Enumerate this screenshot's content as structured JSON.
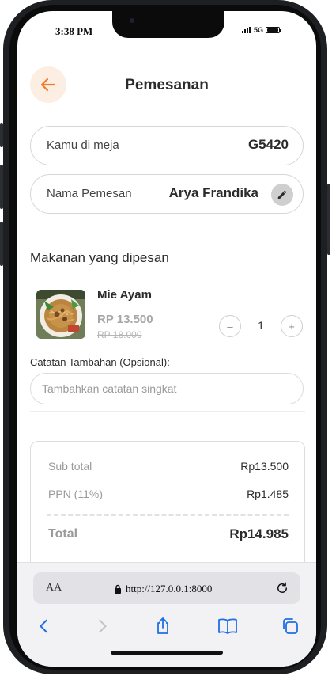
{
  "status_bar": {
    "time": "3:38 PM",
    "network": "5G"
  },
  "header": {
    "title": "Pemesanan",
    "back_icon": "arrow-left-icon"
  },
  "colors": {
    "accent": "#f07c2c",
    "accent_soft": "#fdeee3",
    "browser_blue": "#1f6fe5"
  },
  "table_info": {
    "label": "Kamu di meja",
    "value": "G5420"
  },
  "customer": {
    "label": "Nama Pemesan",
    "value": "Arya Frandika",
    "edit_icon": "pencil-icon"
  },
  "order_section": {
    "title": "Makanan yang dipesan"
  },
  "items": [
    {
      "name": "Mie Ayam",
      "price": "RP 13.500",
      "original_price": "RP 18.000",
      "quantity": "1",
      "image_icon": "noodle-bowl-image"
    }
  ],
  "notes": {
    "label": "Catatan Tambahan (Opsional):",
    "placeholder": "Tambahkan catatan singkat",
    "value": ""
  },
  "summary": {
    "subtotal_label": "Sub total",
    "subtotal_value": "Rp13.500",
    "tax_label": "PPN (11%)",
    "tax_value": "Rp1.485",
    "total_label": "Total",
    "total_value": "Rp14.985"
  },
  "browser": {
    "text_size_label": "AA",
    "url": "http://127.0.0.1:8000",
    "icons": [
      "back-chevron-icon",
      "forward-chevron-icon",
      "share-icon",
      "bookmarks-icon",
      "tabs-icon",
      "reload-icon",
      "lock-icon"
    ]
  }
}
